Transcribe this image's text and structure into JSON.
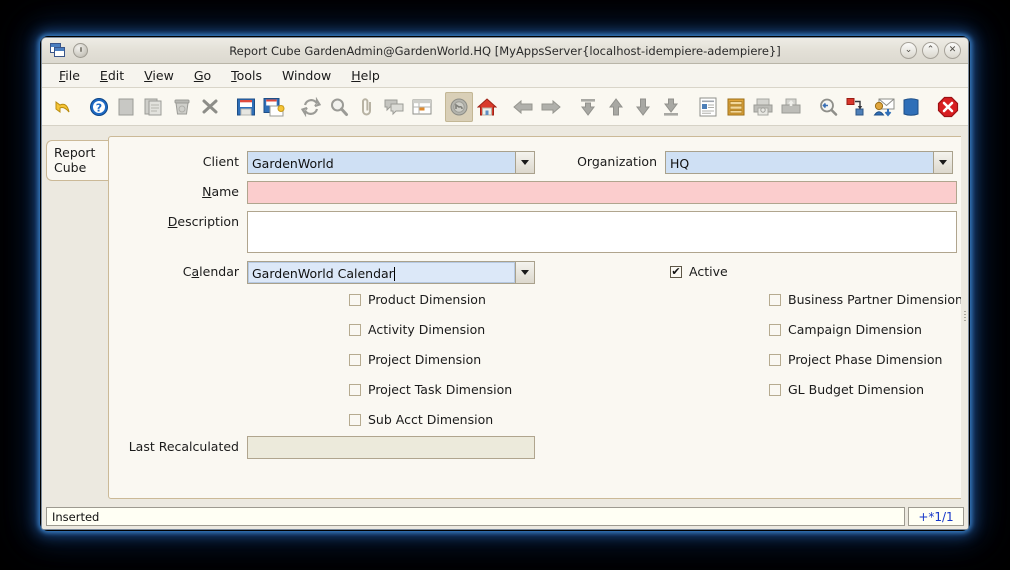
{
  "window": {
    "title": "Report Cube  GardenAdmin@GardenWorld.HQ [MyAppsServer{localhost-idempiere-adempiere}]",
    "minimize_label": "⌄",
    "maximize_label": "⌃",
    "close_label": "✕"
  },
  "menubar": {
    "items": [
      {
        "label": "File",
        "mnemonic": "F"
      },
      {
        "label": "Edit",
        "mnemonic": "E"
      },
      {
        "label": "View",
        "mnemonic": "V"
      },
      {
        "label": "Go",
        "mnemonic": "G"
      },
      {
        "label": "Tools",
        "mnemonic": "T"
      },
      {
        "label": "Window",
        "mnemonic": ""
      },
      {
        "label": "Help",
        "mnemonic": "H"
      }
    ]
  },
  "toolbar": {
    "items": [
      {
        "name": "undo-icon",
        "title": "Undo"
      },
      {
        "name": "help-icon",
        "title": "Help"
      },
      {
        "name": "new-record-icon",
        "title": "New Record"
      },
      {
        "name": "copy-record-icon",
        "title": "Copy Record"
      },
      {
        "name": "delete-record-icon",
        "title": "Delete Record"
      },
      {
        "name": "delete-selection-icon",
        "title": "Delete Selection"
      },
      {
        "name": "save-icon",
        "title": "Save Changes"
      },
      {
        "name": "save-create-icon",
        "title": "Save and Create New"
      },
      {
        "name": "refresh-icon",
        "title": "Refresh"
      },
      {
        "name": "find-icon",
        "title": "Find"
      },
      {
        "name": "attachment-icon",
        "title": "Attachment"
      },
      {
        "name": "chat-icon",
        "title": "Chat"
      },
      {
        "name": "grid-toggle-icon",
        "title": "Toggle Grid"
      },
      {
        "name": "history-icon",
        "title": "History Records",
        "selected": true
      },
      {
        "name": "home-icon",
        "title": "Home"
      },
      {
        "name": "arrow-left-icon",
        "title": "Parent Record"
      },
      {
        "name": "arrow-right-icon",
        "title": "Detail Record"
      },
      {
        "name": "first-record-icon",
        "title": "First Record"
      },
      {
        "name": "previous-record-icon",
        "title": "Previous Record"
      },
      {
        "name": "next-record-icon",
        "title": "Next Record"
      },
      {
        "name": "last-record-icon",
        "title": "Last Record"
      },
      {
        "name": "report-icon",
        "title": "Report"
      },
      {
        "name": "archive-icon",
        "title": "Archived Documents"
      },
      {
        "name": "print-preview-icon",
        "title": "Print Preview"
      },
      {
        "name": "print-icon",
        "title": "Print"
      },
      {
        "name": "zoom-across-icon",
        "title": "Zoom Across"
      },
      {
        "name": "active-workflow-icon",
        "title": "Active Workflows"
      },
      {
        "name": "request-icon",
        "title": "Requests"
      },
      {
        "name": "product-info-icon",
        "title": "Product Info"
      },
      {
        "name": "exit-icon",
        "title": "Exit"
      }
    ]
  },
  "tabs": {
    "active": "Report Cube",
    "items": [
      {
        "label": "Report Cube"
      }
    ]
  },
  "form": {
    "client": {
      "label": "Client",
      "value": "GardenWorld"
    },
    "organization": {
      "label": "Organization",
      "value": "HQ"
    },
    "name": {
      "label": "Name",
      "mnemonic": "N",
      "value": ""
    },
    "description": {
      "label": "Description",
      "mnemonic": "D",
      "value": ""
    },
    "calendar": {
      "label": "Calendar",
      "mnemonic": "a",
      "value": "GardenWorld Calendar"
    },
    "last_recalculated": {
      "label": "Last Recalculated",
      "value": ""
    },
    "active": {
      "label": "Active",
      "checked": true
    },
    "checkboxes_left": [
      {
        "label": "Product Dimension",
        "checked": false
      },
      {
        "label": "Activity Dimension",
        "checked": false
      },
      {
        "label": "Project Dimension",
        "checked": false
      },
      {
        "label": "Project Task  Dimension",
        "checked": false
      },
      {
        "label": "Sub Acct Dimension",
        "checked": false
      }
    ],
    "checkboxes_right": [
      {
        "label": "Business Partner Dimension",
        "checked": false
      },
      {
        "label": "Campaign Dimension",
        "checked": false
      },
      {
        "label": "Project Phase  Dimension",
        "checked": false
      },
      {
        "label": "GL Budget Dimension",
        "checked": false
      }
    ]
  },
  "statusbar": {
    "message": "Inserted",
    "record_indicator": "+*1/1"
  },
  "colors": {
    "required_field": "#fbcdcd",
    "lookup_field": "#cfe0f4",
    "readonly_field": "#eceadb",
    "panel_bg": "#faf8f2",
    "window_bg": "#ece9e0",
    "accent_blue": "#1636c8",
    "tab_border": "#cbb997"
  }
}
